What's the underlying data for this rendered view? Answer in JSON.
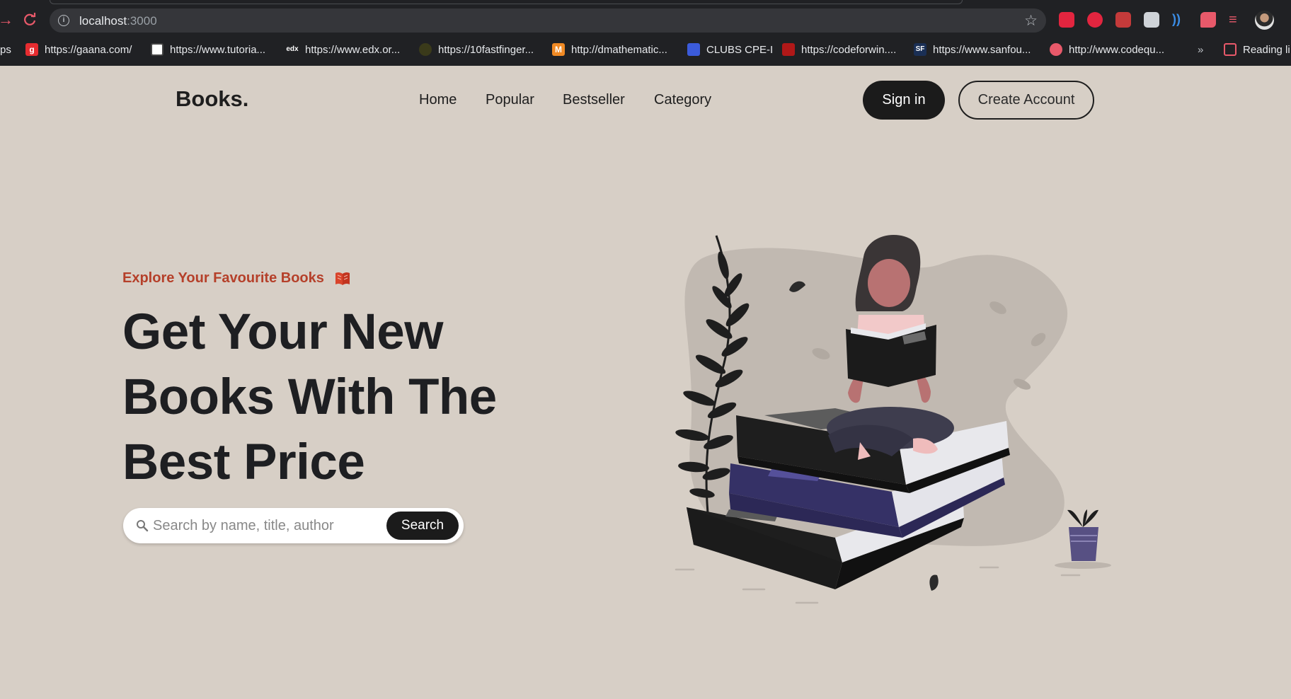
{
  "browser": {
    "url_host": "localhost",
    "url_port": ":3000",
    "bookmarks": [
      {
        "label": "ps",
        "icon": "apps-icon"
      },
      {
        "label": "https://gaana.com/",
        "icon": "gaana-icon"
      },
      {
        "label": "https://www.tutoria...",
        "icon": "tutorialspoint-icon"
      },
      {
        "label": "https://www.edx.or...",
        "icon": "edx-icon"
      },
      {
        "label": "https://10fastfinger...",
        "icon": "10fastfingers-icon"
      },
      {
        "label": "http://dmathematic...",
        "icon": "mathematics-icon"
      },
      {
        "label": "CLUBS CPE-I",
        "icon": "clubs-icon"
      },
      {
        "label": "https://codeforwin....",
        "icon": "codeforwin-icon"
      },
      {
        "label": "https://www.sanfou...",
        "icon": "sanfoundry-icon"
      },
      {
        "label": "http://www.codequ...",
        "icon": "codequotient-icon"
      }
    ],
    "more_bookmarks": "»",
    "reading_list": "Reading li"
  },
  "header": {
    "logo": "Books.",
    "nav": [
      "Home",
      "Popular",
      "Bestseller",
      "Category"
    ],
    "signin_label": "Sign in",
    "create_account_label": "Create Account"
  },
  "hero": {
    "tagline": "Explore Your Favourite Books",
    "headline_lines": [
      "Get Your New",
      "Books With The",
      "Best Price"
    ],
    "search_placeholder": "Search by name, title, author",
    "search_button": "Search"
  },
  "colors": {
    "background": "#d7cfc6",
    "accent": "#b5402a",
    "dark": "#1b1b1b",
    "book_blue": "#353166"
  }
}
